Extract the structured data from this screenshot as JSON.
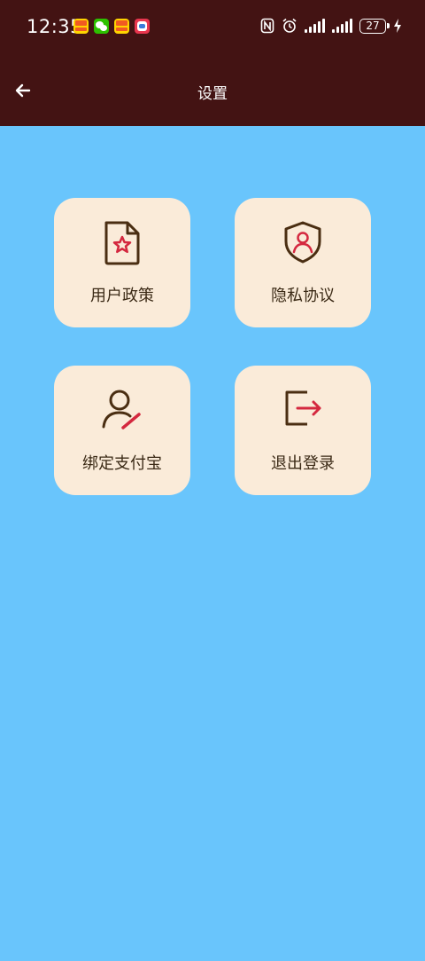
{
  "status_bar": {
    "time": "12:35",
    "notification_icons": [
      "meituan-icon",
      "wechat-icon",
      "meituan-icon",
      "game-app-icon"
    ],
    "status_icons": [
      "nfc-icon",
      "alarm-icon",
      "signal-icon",
      "signal-icon"
    ],
    "battery": "27"
  },
  "nav": {
    "title": "设置",
    "back_icon": "arrow-left-icon"
  },
  "menu": {
    "items": [
      {
        "label": "用户政策",
        "icon": "document-star-icon"
      },
      {
        "label": "隐私协议",
        "icon": "shield-user-icon"
      },
      {
        "label": "绑定支付宝",
        "icon": "user-edit-icon"
      },
      {
        "label": "退出登录",
        "icon": "logout-icon"
      }
    ]
  },
  "colors": {
    "header_bg": "#431313",
    "page_bg": "#69C5FC",
    "card_bg": "#FAEBD9",
    "icon_dark": "#4A2E12",
    "icon_accent": "#D4283F",
    "label_text": "#3B2A16"
  }
}
